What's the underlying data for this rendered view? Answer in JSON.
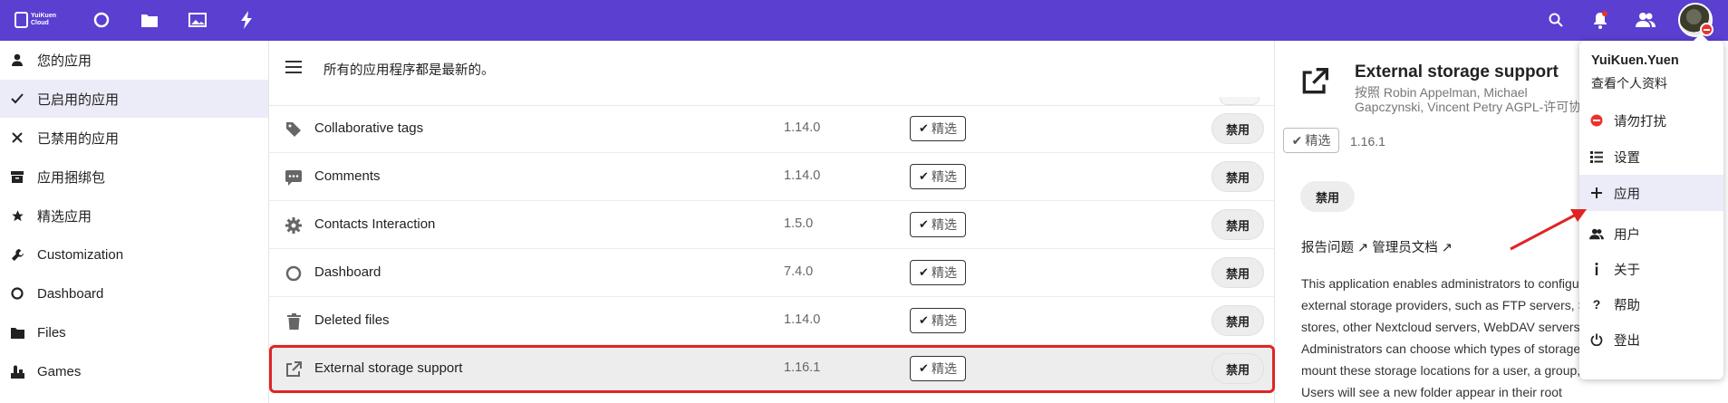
{
  "topbar": {
    "brand_line1": "YuiKuen",
    "brand_line2": "Cloud",
    "apps": [
      {
        "name": "dashboard-icon"
      },
      {
        "name": "files-icon"
      },
      {
        "name": "photos-icon"
      },
      {
        "name": "activity-icon"
      }
    ],
    "right_icons": [
      "search-icon",
      "notifications-icon",
      "contacts-icon"
    ]
  },
  "sidebar": {
    "items": [
      {
        "label": "您的应用",
        "icon": "person-icon",
        "active": false
      },
      {
        "label": "已启用的应用",
        "icon": "check-icon",
        "active": true
      },
      {
        "label": "已禁用的应用",
        "icon": "close-icon",
        "active": false
      },
      {
        "label": "应用捆绑包",
        "icon": "archive-icon",
        "active": false
      },
      {
        "label": "精选应用",
        "icon": "star-icon",
        "active": false
      },
      {
        "label": "Customization",
        "icon": "wrench-icon",
        "active": false
      },
      {
        "label": "Dashboard",
        "icon": "circle-icon",
        "active": false
      },
      {
        "label": "Files",
        "icon": "folder-icon",
        "active": false
      },
      {
        "label": "Games",
        "icon": "games-icon",
        "active": false
      }
    ]
  },
  "main": {
    "status": "所有的应用程序都是最新的。",
    "featured_label": "精选",
    "disable_label": "禁用",
    "apps": [
      {
        "name": "Collaborative tags",
        "version": "1.14.0",
        "icon": "tag-icon"
      },
      {
        "name": "Comments",
        "version": "1.14.0",
        "icon": "comment-icon"
      },
      {
        "name": "Contacts Interaction",
        "version": "1.5.0",
        "icon": "gear-icon"
      },
      {
        "name": "Dashboard",
        "version": "7.4.0",
        "icon": "circle-icon"
      },
      {
        "name": "Deleted files",
        "version": "1.14.0",
        "icon": "trash-icon"
      },
      {
        "name": "External storage support",
        "version": "1.16.1",
        "icon": "external-link-icon"
      }
    ]
  },
  "detail": {
    "title": "External storage support",
    "authors": "按照 Robin Appelman, Michael Gapczynski, Vincent Petry AGPL-许可协议",
    "featured_label": "精选",
    "version": "1.16.1",
    "disable_label": "禁用",
    "links": "报告问题 ↗ 管理员文档 ↗",
    "description": "This application enables administrators to configure connections to external storage providers, such as FTP servers, S3 or SWIFT object stores, other Nextcloud servers, WebDAV servers, and more. Administrators can choose which types of storage to enable and can mount these storage locations for a user, a group, or the entire system. Users will see a new folder appear in their root"
  },
  "user_menu": {
    "username": "YuiKuen.Yuen",
    "profile": "查看个人资料",
    "items": [
      {
        "label": "请勿打扰",
        "icon": "dnd-icon",
        "active": false
      },
      {
        "label": "设置",
        "icon": "settings-list-icon",
        "active": false
      },
      {
        "label": "应用",
        "icon": "plus-icon",
        "active": true
      },
      {
        "label": "用户",
        "icon": "users-icon",
        "active": false
      },
      {
        "label": "关于",
        "icon": "info-icon",
        "active": false
      },
      {
        "label": "帮助",
        "icon": "help-icon",
        "active": false
      },
      {
        "label": "登出",
        "icon": "power-icon",
        "active": false
      }
    ]
  },
  "colors": {
    "header": "#5b3fd1",
    "highlight_border": "#e02424",
    "active_item": "#ecebf8",
    "dnd_red": "#e9322d"
  }
}
